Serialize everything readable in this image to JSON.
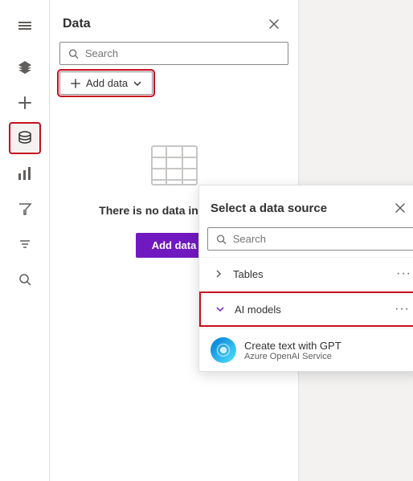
{
  "sidebar": {
    "items": [
      {
        "name": "hamburger",
        "label": "Menu",
        "active": false
      },
      {
        "name": "layers",
        "label": "Layers",
        "active": false
      },
      {
        "name": "add",
        "label": "Add",
        "active": false
      },
      {
        "name": "database",
        "label": "Data",
        "active": true
      },
      {
        "name": "chart",
        "label": "Chart",
        "active": false
      },
      {
        "name": "filter",
        "label": "Filter",
        "active": false
      },
      {
        "name": "tools",
        "label": "Tools",
        "active": false
      },
      {
        "name": "search",
        "label": "Search",
        "active": false
      }
    ]
  },
  "dataPanel": {
    "title": "Data",
    "searchPlaceholder": "Search",
    "addDataLabel": "Add data",
    "noDataText": "There is no data in your app",
    "addDataButtonLabel": "Add data"
  },
  "dataSourcePanel": {
    "title": "Select a data source",
    "searchPlaceholder": "Search",
    "items": [
      {
        "name": "Tables",
        "type": "collapsed"
      },
      {
        "name": "AI models",
        "type": "expanded"
      }
    ],
    "gptItem": {
      "name": "Create text with GPT",
      "sub": "Azure OpenAI Service"
    }
  }
}
